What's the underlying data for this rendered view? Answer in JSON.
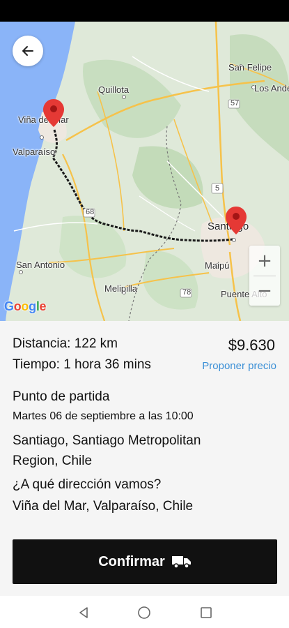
{
  "map": {
    "labels": {
      "vina": "Viña del Mar",
      "valparaiso": "Valparaíso",
      "quillota": "Quillota",
      "san_felipe": "San Felipe",
      "los_andes": "Los Andes",
      "santiago": "Santiago",
      "maipu": "Maipú",
      "san_antonio": "San Antonio",
      "melipilla": "Melipilla",
      "puente_alto": "Puente Alto"
    },
    "route_shields": {
      "r57": "57",
      "r5": "5",
      "r68": "68",
      "r78": "78"
    },
    "zoom_in": "+",
    "zoom_out": "−",
    "google": [
      "G",
      "o",
      "o",
      "g",
      "l",
      "e"
    ],
    "route_color": "#1a1a1a",
    "pin_color": "#e53935"
  },
  "trip": {
    "distance": "Distancia: 122 km",
    "time": "Tiempo: 1 hora 36 mins",
    "price": "$9.630",
    "propose_price": "Proponer precio"
  },
  "origin": {
    "title": "Punto de partida",
    "datetime": "Martes 06 de septiembre a las 10:00",
    "address": "Santiago, Santiago Metropolitan Region, Chile"
  },
  "destination": {
    "title": "¿A qué dirección vamos?",
    "address": "Viña del Mar, Valparaíso, Chile"
  },
  "confirm_button": {
    "label": "Confirmar",
    "icon": "truck-icon"
  },
  "colors": {
    "accent_link": "#3a8fd6",
    "button_bg": "#111111"
  }
}
